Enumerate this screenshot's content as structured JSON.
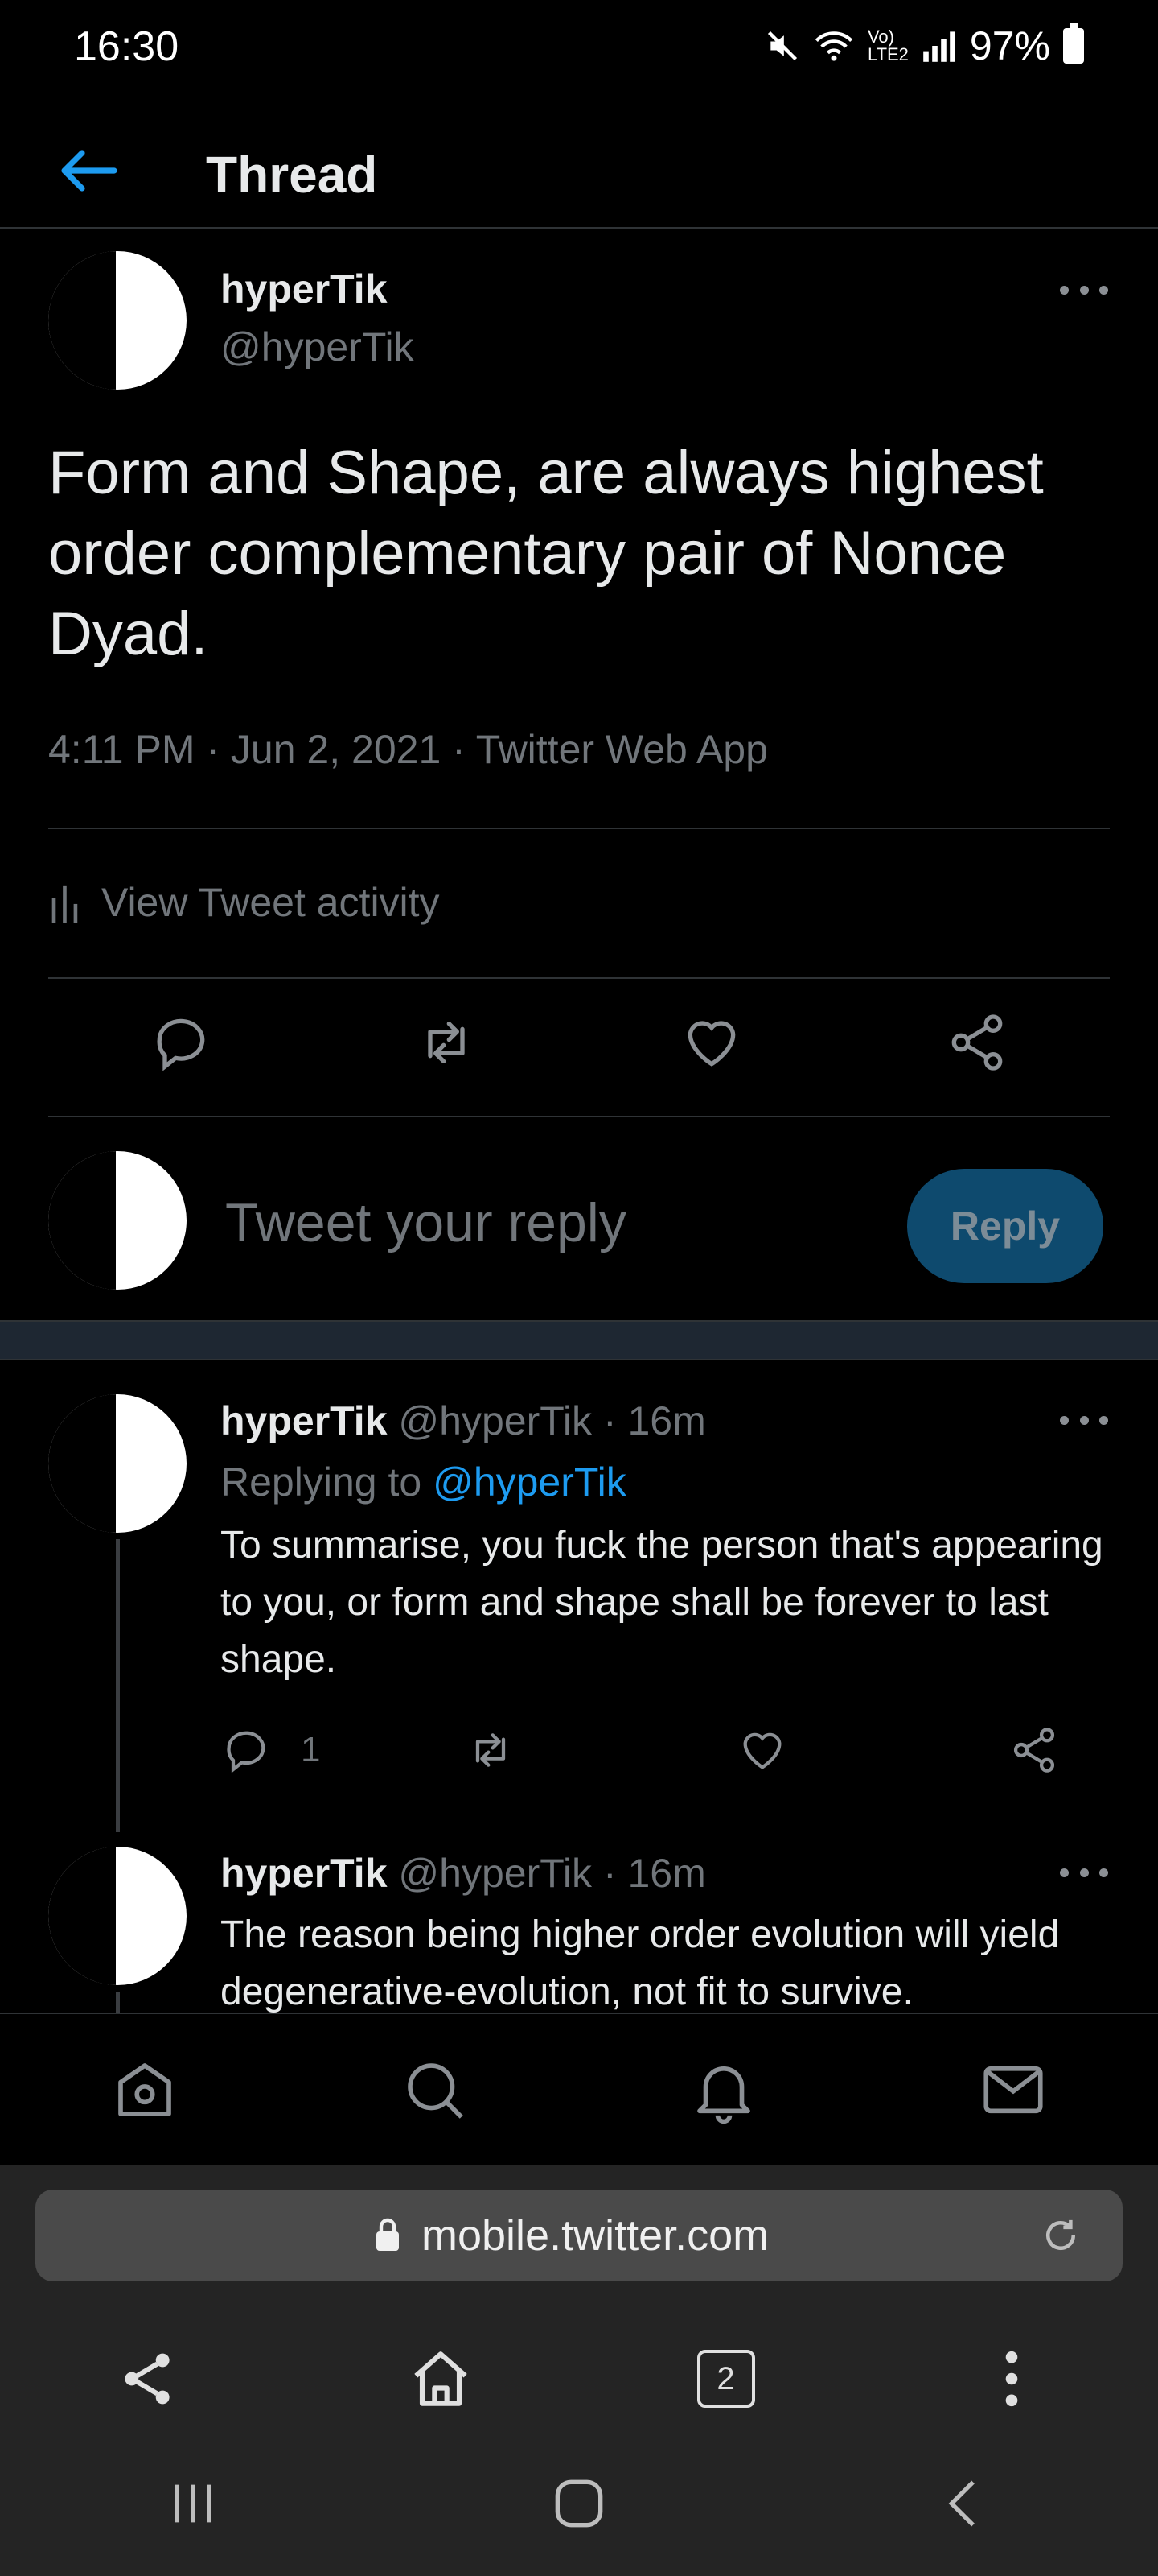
{
  "status_bar": {
    "time": "16:30",
    "battery": "97%"
  },
  "header": {
    "title": "Thread"
  },
  "tweet": {
    "name": "hyperTik",
    "handle": "@hyperTik",
    "text": "Form and Shape, are always highest order complementary pair of Nonce Dyad.",
    "meta": "4:11 PM · Jun 2, 2021 · Twitter Web App",
    "activity_label": "View Tweet activity"
  },
  "compose": {
    "placeholder": "Tweet your reply",
    "button_label": "Reply"
  },
  "replies": [
    {
      "name": "hyperTik",
      "handle": "@hyperTik",
      "time": "· 16m",
      "replying_prefix": "Replying to",
      "replying_to": "@hyperTik",
      "text": "To summarise, you fuck the person that's appearing to you, or form and shape shall be forever to last shape.",
      "reply_count": "1"
    },
    {
      "name": "hyperTik",
      "handle": "@hyperTik",
      "time": "· 16m",
      "text": "The reason being higher order evolution will yield degenerative-evolution, not fit to survive."
    }
  ],
  "browser": {
    "url": "mobile.twitter.com",
    "tab_count": "2"
  },
  "colors": {
    "accent": "#1d9bf0",
    "background": "#000000",
    "muted": "#71767b"
  }
}
